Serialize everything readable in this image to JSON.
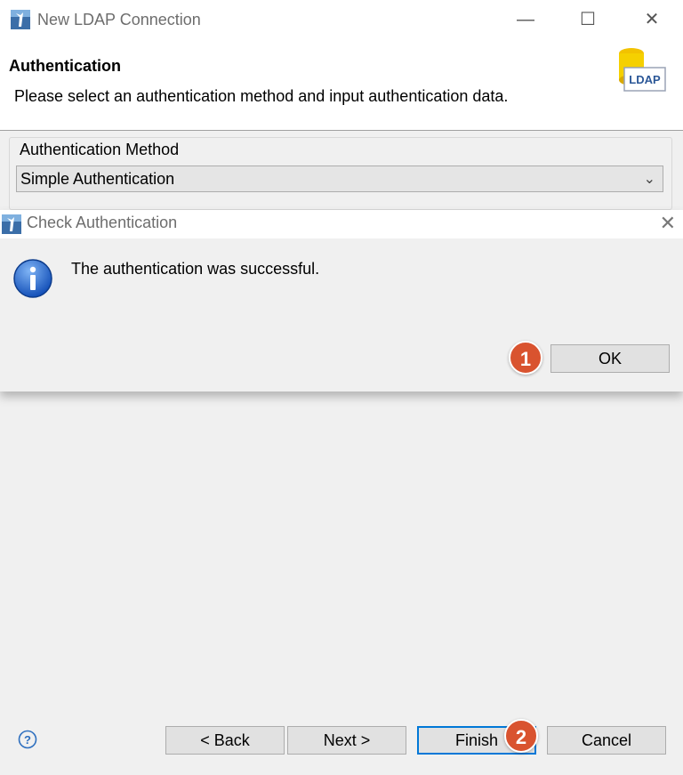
{
  "window": {
    "title": "New LDAP Connection",
    "minimize_icon": "minimize-icon",
    "maximize_icon": "maximize-icon",
    "close_icon": "close-icon"
  },
  "header": {
    "title": "Authentication",
    "description": "Please select an authentication method and input authentication data.",
    "logo_text": "LDAP"
  },
  "auth_method": {
    "label": "Authentication Method",
    "selected": "Simple Authentication"
  },
  "dialog": {
    "title": "Check Authentication",
    "message": "The authentication was successful.",
    "ok_label": "OK",
    "icon": "info-icon"
  },
  "footer": {
    "back_label": "< Back",
    "next_label": "Next >",
    "finish_label": "Finish",
    "cancel_label": "Cancel"
  },
  "badges": [
    "1",
    "2"
  ],
  "colors": {
    "badge": "#d9532f",
    "accent": "#0078d7"
  }
}
